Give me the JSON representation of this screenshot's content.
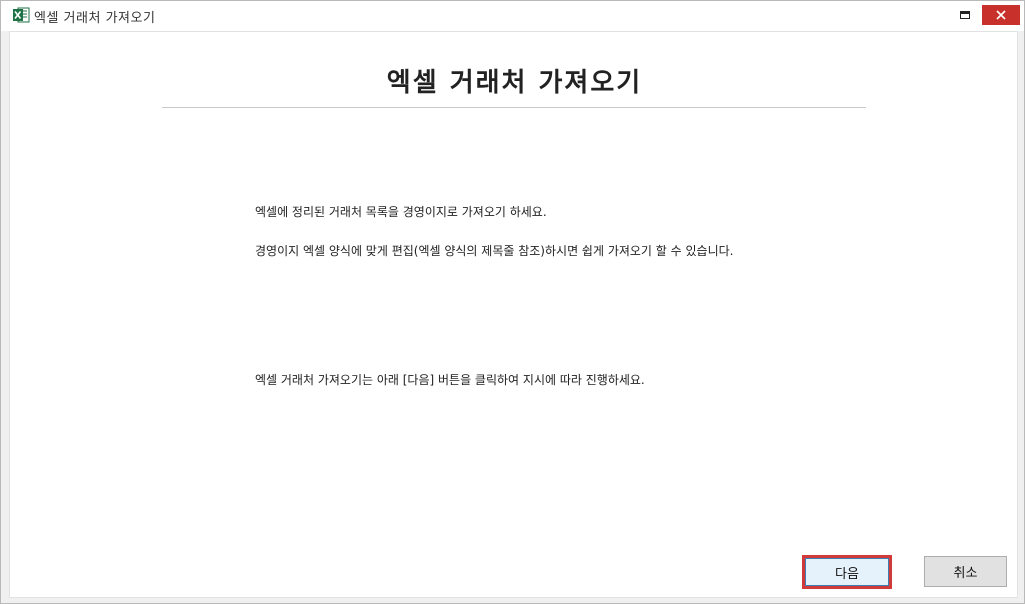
{
  "window": {
    "title": "엑셀 거래처 가져오기",
    "app_icon": "excel-icon",
    "close_color": "#c7302b"
  },
  "main": {
    "heading": "엑셀 거래처 가져오기",
    "paragraphs": [
      "엑셀에 정리된 거래처 목록을 경영이지로 가져오기 하세요.",
      "경영이지 엑셀 양식에 맞게 편집(엑셀 양식의 제목줄 참조)하시면 쉽게 가져오기 할 수 있습니다.",
      "엑셀 거래처 가져오기는 아래 [다음] 버튼을 클릭하여 지시에 따라 진행하세요."
    ]
  },
  "buttons": {
    "next_label": "다음",
    "cancel_label": "취소"
  }
}
